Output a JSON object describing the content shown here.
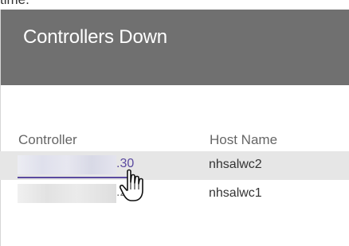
{
  "window": {
    "top_fragment": "time."
  },
  "panel": {
    "title": "Controllers Down"
  },
  "table": {
    "columns": [
      "Controller",
      "Host Name"
    ],
    "rows": [
      {
        "controller_suffix": ".30",
        "host_name": "nhsalwc2",
        "is_link": true
      },
      {
        "controller_suffix": ".29",
        "host_name": "nhsalwc1",
        "is_link": false
      }
    ]
  },
  "cursor": {
    "icon": "hand-pointer-icon"
  },
  "colors": {
    "header_bg": "#707070",
    "link": "#5b4aa0",
    "row_highlight": "#e6e6e6"
  }
}
